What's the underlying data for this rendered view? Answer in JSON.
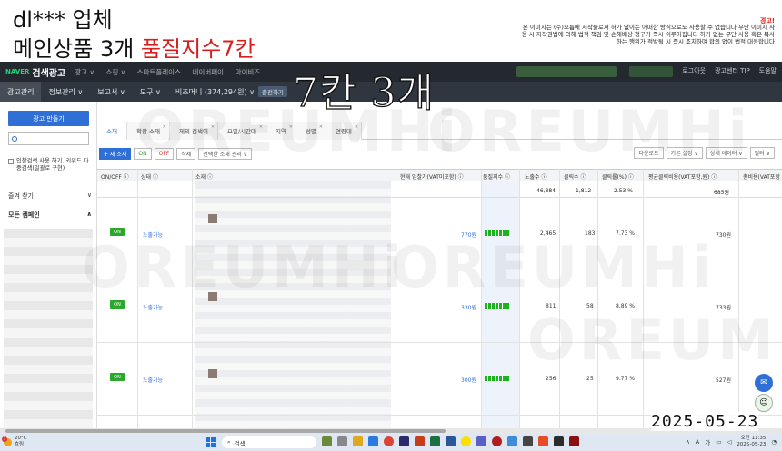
{
  "caption": {
    "line1": "dl*** 업체",
    "line2_black": "메인상품 3개 ",
    "line2_red": "품질지수7칸",
    "notice_title": "경고!",
    "notice_text": "본 이미지는 (주)오름에 저작물로서 허가 없이는 어떠한 방식으로도 사용할 수 없습니다 무단 이미지 사용 시 저작권법에 의해 법적 책임 및 손해배상 청구가 즉시 이루어집니다 허가 없는 무단 사용 혹은 복사하는 행위가 적발될 시 즉시 조치하며 합의 없이 법적 대응합니다"
  },
  "overlay_text": "7칸 3개",
  "topbar": {
    "brand_naver": "NAVER",
    "brand_name": "검색광고",
    "nav": [
      "광고 ∨",
      "쇼핑 ∨",
      "스마트플레이스",
      "네이버페이",
      "마이비즈"
    ],
    "right": [
      "로그아웃",
      "광고센터 TIP",
      "도움말"
    ]
  },
  "subnav": {
    "items": [
      "광고관리",
      "정보관리 ∨",
      "보고서 ∨",
      "도구 ∨",
      "비즈머니 (374,294원) ∨"
    ],
    "charge_btn": "충전하기"
  },
  "sidebar": {
    "create_btn": "광고 만들기",
    "checkbox_label": "입찰검색 사용 하기, 키워드 다중검색(일괄로 구현)",
    "section_fav": "즐겨 찾기",
    "section_all": "모든 캠페인"
  },
  "tabs": [
    {
      "label": "소재",
      "active": true
    },
    {
      "label": "확장 소재",
      "active": false
    },
    {
      "label": "제외 검색어",
      "active": false
    },
    {
      "label": "요일/시간대",
      "active": false
    },
    {
      "label": "지역",
      "active": false
    },
    {
      "label": "성별",
      "active": false
    },
    {
      "label": "연령대",
      "active": false
    }
  ],
  "toolbar": {
    "new": "+ 새 소재",
    "on": "ON",
    "off": "OFF",
    "delete": "삭제",
    "bulk": "선택한 소재 관리 ∨",
    "right": [
      "다운로드",
      "기본 설정 ∨",
      "상세 데이터 ∨",
      "필터 ∨"
    ]
  },
  "table": {
    "headers": [
      "ON/OFF ⓘ",
      "상태 ⓘ",
      "소재 ⓘ",
      "현재 입찰가(VAT미포함) ⓘ",
      "품질지수 ⓘ",
      "노출수 ⓘ",
      "클릭수 ⓘ",
      "클릭률(%) ⓘ",
      "평균클릭비용(VAT포함,원) ⓘ",
      "총비용(VAT포함"
    ],
    "summary": {
      "impressions": "46,884",
      "clicks": "1,812",
      "ctr": "2.53 %",
      "cost": "685원"
    },
    "rows": [
      {
        "toggle": "ON",
        "status": "노출가능",
        "bid": "770원",
        "impressions": "2,465",
        "clicks": "183",
        "ctr": "7.73 %",
        "cpc": "730원"
      },
      {
        "toggle": "ON",
        "status": "노출가능",
        "bid": "330원",
        "impressions": "811",
        "clicks": "58",
        "ctr": "8.89 %",
        "cpc": "733원"
      },
      {
        "toggle": "ON",
        "status": "노출가능",
        "bid": "300원",
        "impressions": "256",
        "clicks": "25",
        "ctr": "9.77 %",
        "cpc": "527원"
      }
    ]
  },
  "watermark": "OREUMHi",
  "date_overlay": "2025-05-23",
  "taskbar": {
    "weather_temp": "20°C",
    "weather_desc": "흐림",
    "badge": "1",
    "search": "검색",
    "ime": "가",
    "lang": "A",
    "time": "오전 11:35",
    "date": "2025-05-23"
  },
  "colors": {
    "accent": "#2f6fd6",
    "topbar": "#24292f",
    "on_green": "#2aa82a",
    "quality_green": "#1db31d",
    "caption_red": "#d71f1f"
  }
}
